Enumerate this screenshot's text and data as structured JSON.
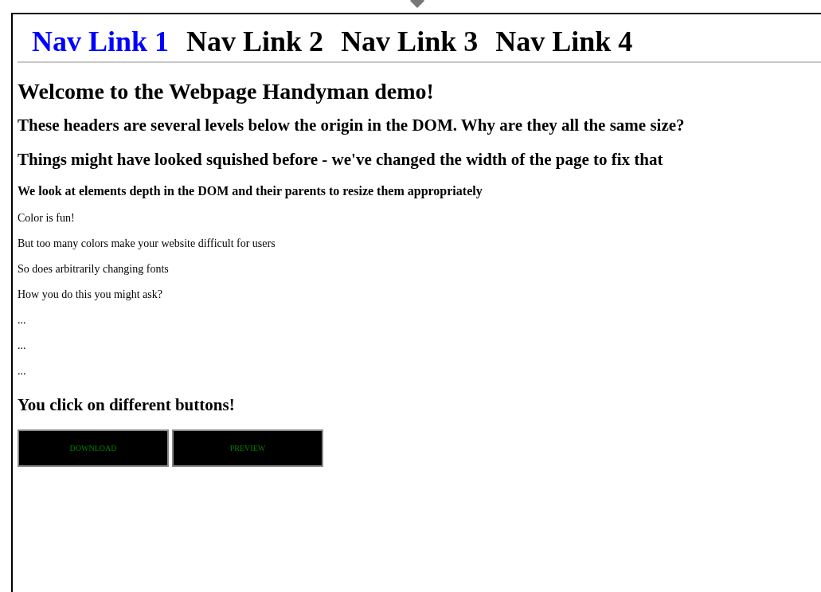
{
  "nav": {
    "links": [
      {
        "label": "Nav Link 1",
        "selected": true
      },
      {
        "label": "Nav Link 2",
        "selected": false
      },
      {
        "label": "Nav Link 3",
        "selected": false
      },
      {
        "label": "Nav Link 4",
        "selected": false
      }
    ]
  },
  "content": [
    {
      "kind": "h1",
      "text": "Welcome to the Webpage Handyman demo!"
    },
    {
      "kind": "h2",
      "text": "These headers are several levels below the origin in the DOM. Why are they all the same size?"
    },
    {
      "kind": "h2",
      "text": "Things might have looked squished before - we've changed the width of the page to fix that"
    },
    {
      "kind": "h4",
      "text": "We look at elements depth in the DOM and their parents to resize them appropriately"
    },
    {
      "kind": "p",
      "text": "Color is fun!"
    },
    {
      "kind": "p",
      "text": "But too many colors make your website difficult for users"
    },
    {
      "kind": "p",
      "text": "So does arbitrarily changing fonts"
    },
    {
      "kind": "p",
      "text": "How you do this you might ask?"
    },
    {
      "kind": "p",
      "text": "..."
    },
    {
      "kind": "p",
      "text": "..."
    },
    {
      "kind": "p",
      "text": "..."
    },
    {
      "kind": "h2",
      "text": "You click on different buttons!"
    }
  ],
  "buttons": [
    "DOWNLOAD",
    "PREVIEW"
  ]
}
